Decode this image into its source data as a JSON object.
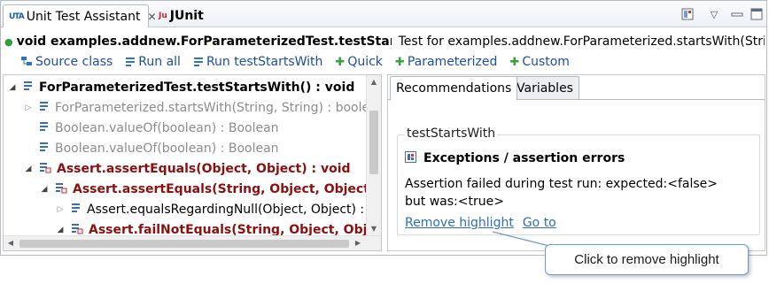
{
  "tabs": [
    {
      "label": "Unit Test Assistant",
      "icon": "uta-icon",
      "active": true
    },
    {
      "label": "JUnit",
      "icon": "junit-icon",
      "active": false
    }
  ],
  "toolbar": {
    "layout_icon": "layout-icon",
    "menu_icon": "view-menu-icon"
  },
  "method": {
    "signature": "void examples.addnew.ForParameterizedTest.testStartsWith()",
    "description": "Test for examples.addnew.ForParameterized.startsWith(String, String)"
  },
  "actions": [
    {
      "label": "Source class",
      "icon": "source-class-icon"
    },
    {
      "label": "Run all",
      "icon": "run-all-icon"
    },
    {
      "label": "Run testStartsWith",
      "icon": "run-test-icon"
    },
    {
      "label": "Quick",
      "icon": "plus-icon"
    },
    {
      "label": "Parameterized",
      "icon": "parameterized-icon"
    },
    {
      "label": "Custom",
      "icon": "plus-icon"
    }
  ],
  "tree": [
    {
      "text": "ForParameterizedTest.testStartsWith() : void",
      "style": "bold",
      "twisty": "open",
      "indent": 0
    },
    {
      "text": "ForParameterized.startsWith(String, String) : boolean",
      "style": "gray",
      "twisty": "closed",
      "indent": 1
    },
    {
      "text": "Boolean.valueOf(boolean) : Boolean",
      "style": "gray",
      "twisty": "none",
      "indent": 1
    },
    {
      "text": "Boolean.valueOf(boolean) : Boolean",
      "style": "gray",
      "twisty": "none",
      "indent": 1
    },
    {
      "text": "Assert.assertEquals(Object, Object) : void",
      "style": "red",
      "twisty": "open",
      "indent": 1
    },
    {
      "text": "Assert.assertEquals(String, Object, Object) : void",
      "style": "red",
      "twisty": "open",
      "indent": 2
    },
    {
      "text": "Assert.equalsRegardingNull(Object, Object) : boolean",
      "style": "normal",
      "twisty": "closed",
      "indent": 3
    },
    {
      "text": "Assert.failNotEquals(String, Object, Object)",
      "style": "red",
      "twisty": "open",
      "indent": 3
    }
  ],
  "right_tabs": [
    "Recommendations",
    "Variables"
  ],
  "group": {
    "label": "testStartsWith",
    "issue_title": "Exceptions / assertion errors",
    "message": "Assertion failed during test run: expected:<false> but was:<true>",
    "links": [
      "Remove highlight",
      "Go to"
    ]
  },
  "tooltip": "Click to remove highlight",
  "colors": {
    "link": "#2e6db8",
    "error_text": "#8b1010",
    "gray_text": "#8c8c8c",
    "pass_dot": "#2e9d3a"
  }
}
